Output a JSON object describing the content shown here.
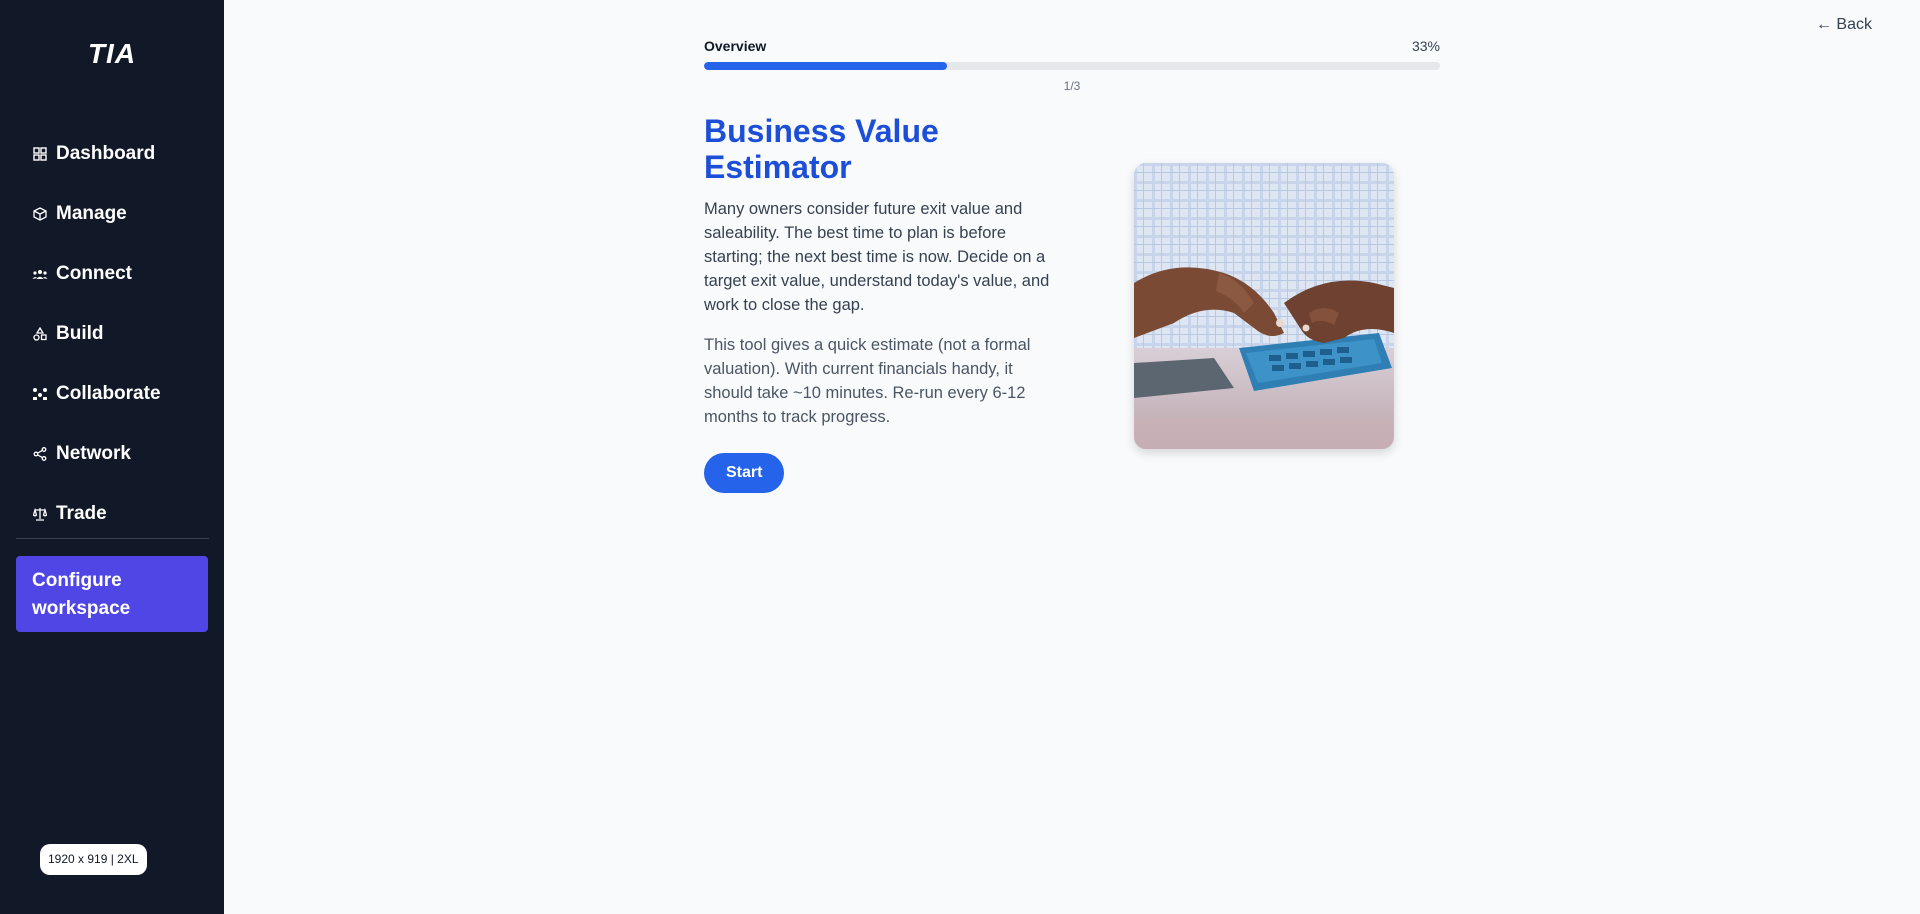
{
  "sidebar": {
    "logo": "TIA",
    "items": [
      {
        "label": "Dashboard",
        "icon": "grid-icon"
      },
      {
        "label": "Manage",
        "icon": "cube-icon"
      },
      {
        "label": "Connect",
        "icon": "users-icon"
      },
      {
        "label": "Build",
        "icon": "shapes-icon"
      },
      {
        "label": "Collaborate",
        "icon": "team-icon"
      },
      {
        "label": "Network",
        "icon": "share-icon"
      },
      {
        "label": "Trade",
        "icon": "scale-icon"
      }
    ],
    "configure_label": "Configure workspace",
    "size_badge": "1920 x 919 | 2XL"
  },
  "header": {
    "back_label": "← Back"
  },
  "progress": {
    "title": "Overview",
    "percent_label": "33%",
    "fraction": 0.33,
    "step": "1/3"
  },
  "main": {
    "title": "Business Value Estimator",
    "paragraph1": "Many owners consider future exit value and saleability. The best time to plan is before starting; the next best time is now. Decide on a target exit value, understand today's value, and work to close the gap.",
    "paragraph2": "This tool gives a quick estimate (not a formal valuation). With current financials handy, it should take ~10 minutes. Re-run every 6-12 months to track progress.",
    "start_label": "Start"
  },
  "colors": {
    "sidebar_bg": "#111827",
    "accent": "#2563eb",
    "title": "#1d4ed8",
    "configure": "#4f46e5"
  }
}
